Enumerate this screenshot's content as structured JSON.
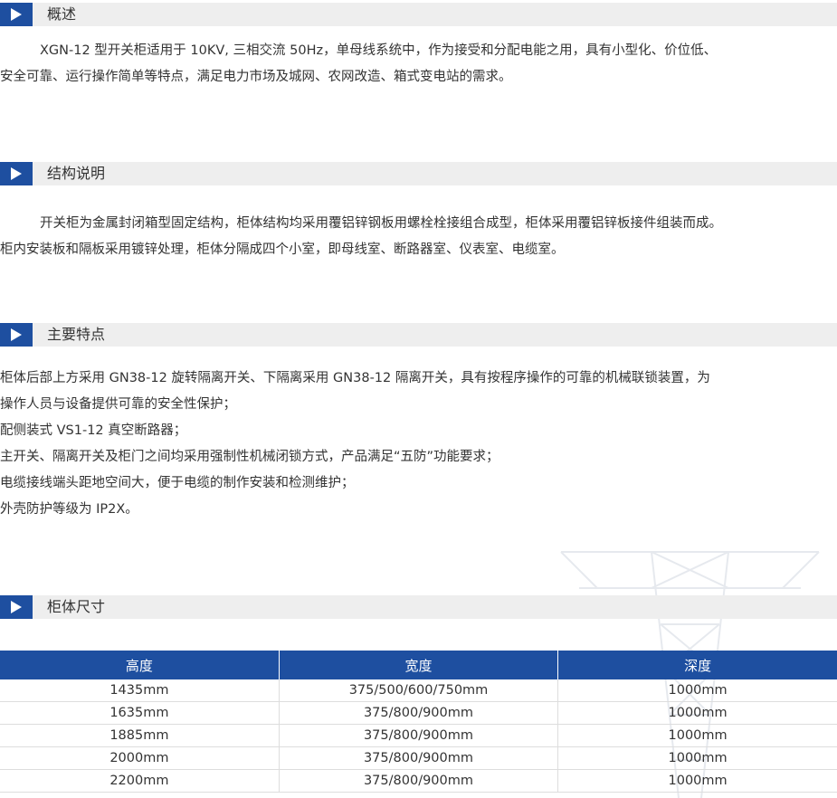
{
  "sections": {
    "overview": {
      "title": "概述",
      "lines": [
        "XGN-12 型开关柜适用于 10KV, 三相交流 50Hz，单母线系统中，作为接受和分配电能之用，具有小型化、价位低、",
        "安全可靠、运行操作简单等特点，满足电力市场及城网、农网改造、箱式变电站的需求。"
      ]
    },
    "structure": {
      "title": "结构说明",
      "lines": [
        "开关柜为金属封闭箱型固定结构，柜体结构均采用覆铝锌钢板用螺栓栓接组合成型，柜体采用覆铝锌板接件组装而成。",
        "柜内安装板和隔板采用镀锌处理，柜体分隔成四个小室，即母线室、断路器室、仪表室、电缆室。"
      ]
    },
    "features": {
      "title": "主要特点",
      "lines": [
        "柜体后部上方采用 GN38-12 旋转隔离开关、下隔离采用 GN38-12 隔离开关，具有按程序操作的可靠的机械联锁装置，为",
        "操作人员与设备提供可靠的安全性保护；",
        "配侧装式 VS1-12 真空断路器；",
        "主开关、隔离开关及柜门之间均采用强制性机械闭锁方式，产品满足“五防”功能要求；",
        "电缆接线端头距地空间大，便于电缆的制作安装和检测维护；",
        "外壳防护等级为 IP2X。"
      ]
    },
    "dimensions": {
      "title": "柜体尺寸",
      "headers": [
        "高度",
        "宽度",
        "深度"
      ],
      "rows": [
        [
          "1435mm",
          "375/500/600/750mm",
          "1000mm"
        ],
        [
          "1635mm",
          "375/800/900mm",
          "1000mm"
        ],
        [
          "1885mm",
          "375/800/900mm",
          "1000mm"
        ],
        [
          "2000mm",
          "375/800/900mm",
          "1000mm"
        ],
        [
          "2200mm",
          "375/800/900mm",
          "1000mm"
        ]
      ]
    }
  },
  "colors": {
    "accent": "#1e4fa0",
    "header_bg": "#eeeeee",
    "text": "#333333"
  },
  "icons": {
    "section_marker": "play-triangle-icon",
    "watermark": "power-tower-watermark"
  }
}
